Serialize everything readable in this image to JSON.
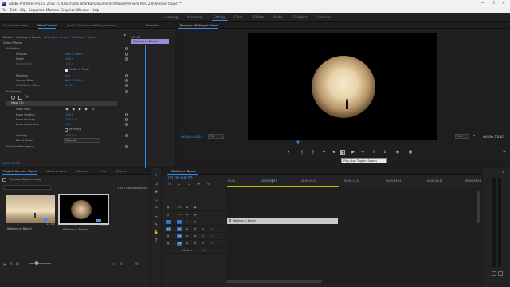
{
  "app": {
    "title": "Adobe Premiere Pro CC 2018 - C:\\Users\\Ravi Shankar\\Documents\\Adobe\\Premiere Pro\\12.0\\Remove Object *",
    "icon_text": "Pr",
    "window_buttons": [
      "—",
      "☐",
      "✕"
    ]
  },
  "menu": [
    "File",
    "Edit",
    "Clip",
    "Sequence",
    "Markers",
    "Graphics",
    "Window",
    "Help"
  ],
  "workspaces": {
    "items": [
      "Learning",
      "Assembly",
      "Editing",
      "Color",
      "Effects",
      "Audio",
      "Graphics",
      "Libraries"
    ],
    "active": "Editing"
  },
  "effect_controls": {
    "tabs": [
      "Source: (no clips)",
      "Effect Controls",
      "Audio Clip Mixer: Walking in Beach",
      "Metadata"
    ],
    "clip_path": "Master * Walking in Beach",
    "clip_selected": "Walking in Beach * Walking in Beach",
    "timeline_clip_label": "Walking in Beach",
    "header_timecode": "00:00",
    "section_video": "Video Effects",
    "rows": [
      {
        "label": "fx  Motion",
        "value": ""
      },
      {
        "label": "Position",
        "value": "960.0     540.0"
      },
      {
        "label": "Scale",
        "value": "100.0"
      },
      {
        "label": "Scale Width",
        "value": "100.0"
      },
      {
        "label": "",
        "value": "Uniform Scale"
      },
      {
        "label": "Rotation",
        "value": "0.0"
      },
      {
        "label": "Anchor Point",
        "value": "960.0     540.0"
      },
      {
        "label": "Anti-flicker Filter",
        "value": "0.00"
      },
      {
        "label": "fx  Opacity",
        "value": ""
      },
      {
        "label": "Mask (1)",
        "value": ""
      },
      {
        "label": "Mask Path",
        "value": ""
      },
      {
        "label": "Mask Feather",
        "value": "132.0"
      },
      {
        "label": "Mask Opacity",
        "value": "100.0 %"
      },
      {
        "label": "Mask Expansion",
        "value": "-1.0"
      },
      {
        "label": "",
        "value": "Inverted"
      },
      {
        "label": "Opacity",
        "value": "100.0 %"
      },
      {
        "label": "Blend Mode",
        "value": "Normal"
      },
      {
        "label": "fx  Time Remapping",
        "value": ""
      }
    ],
    "footer_timecode": "00:00:04:20"
  },
  "program": {
    "tab": "Program: Walking in Beach",
    "timecode": "00:00:04:20",
    "fit": "Fit",
    "quality": "Full",
    "duration": "00:00:13:01",
    "tooltip": "Play-Stop Toggle (Space)"
  },
  "project": {
    "tabs": [
      "Project: Remove Object",
      "Media Browser",
      "Libraries",
      "Info",
      "Effects"
    ],
    "file": "Remove Object.prproj",
    "items_selected": "1 of 3 items selected",
    "thumbs": [
      {
        "label": "Walking in Beach",
        "duration": "13:01"
      },
      {
        "label": "Walking in Beach",
        "duration": "13:01"
      }
    ]
  },
  "timeline": {
    "tab": "Walking in Beach",
    "timecode": "00:00:04:20",
    "ruler": [
      "00:00",
      "00:00:04:23",
      "00:00:09:23",
      "00:00:14:23",
      "00:00:19:23",
      "00:00:24:23",
      "00:00:29:23"
    ],
    "tracks_video": [
      "V3",
      "V2",
      "V1"
    ],
    "tracks_audio": [
      "A1",
      "A2",
      "A3"
    ],
    "master": "Master",
    "master_value": "0.0",
    "clip_label": "Walking in Beach",
    "playhead_fraction": 0.18
  },
  "colors": {
    "accent": "#2d8ceb",
    "clip": "#c9c9c9",
    "tab_selected": "#9d8cd6"
  }
}
